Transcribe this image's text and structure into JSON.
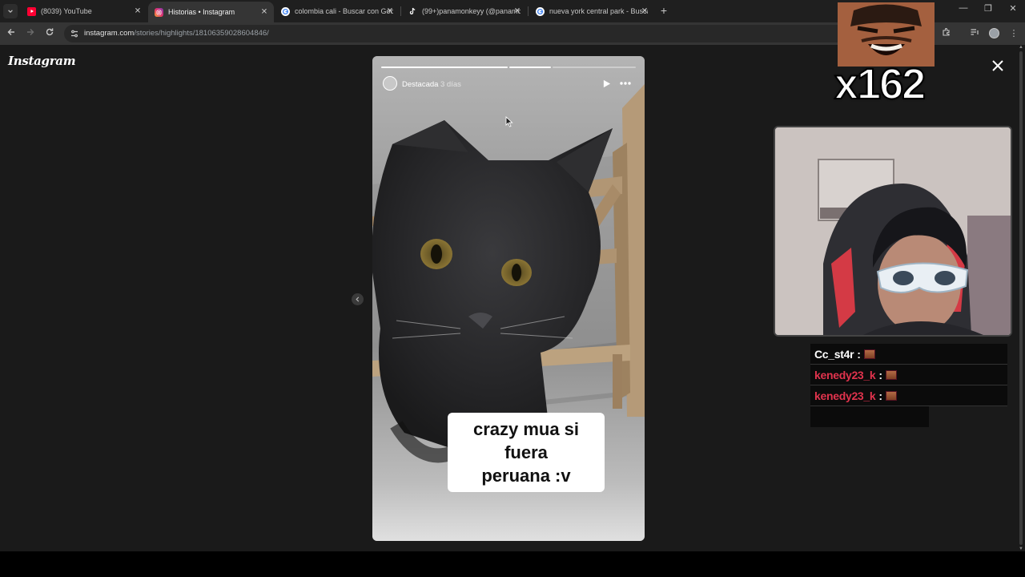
{
  "browser": {
    "tabs": [
      {
        "label": "(8039) YouTube",
        "favicon": "youtube-icon",
        "color": "#ff0033",
        "active": false
      },
      {
        "label": "Historias • Instagram",
        "favicon": "instagram-icon",
        "color": "#e1306c",
        "active": true
      },
      {
        "label": "colombia cali - Buscar con Goo",
        "favicon": "google-icon",
        "color": "#ffffff",
        "active": false
      },
      {
        "label": "(99+)panamonkeyy (@panamo",
        "favicon": "tiktok-icon",
        "color": "#ffffff",
        "active": false
      },
      {
        "label": "nueva york central park - Busca",
        "favicon": "google-icon",
        "color": "#ffffff",
        "active": false
      }
    ],
    "new_tab": "+",
    "url_host": "instagram.com",
    "url_path": "/stories/highlights/18106359028604846/"
  },
  "instagram": {
    "logo": "Instagram",
    "story": {
      "username": "Destacada",
      "time": "3 días",
      "caption_line1": "crazy mua si fuera",
      "caption_line2": "peruana :v"
    }
  },
  "overlay": {
    "emote_counter": "x162",
    "chat": [
      {
        "user": "Cc_st4r",
        "color": "#ffffff"
      },
      {
        "user": "kenedy23_k",
        "color": "#e0334d"
      },
      {
        "user": "kenedy23_k",
        "color": "#e0334d"
      }
    ]
  }
}
